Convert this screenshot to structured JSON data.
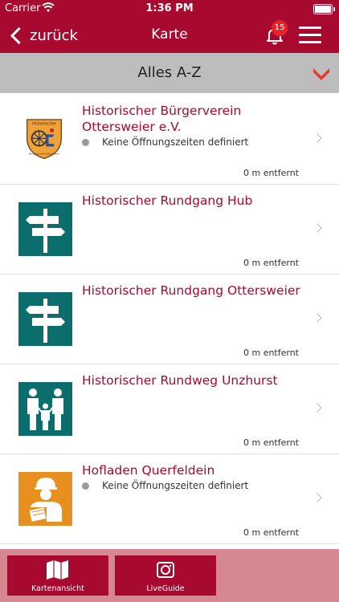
{
  "status_bar": {
    "carrier": "Carrier",
    "time": "1:36 PM"
  },
  "nav": {
    "back_label": "zurück",
    "title": "Karte",
    "notification_count": "15"
  },
  "filter": {
    "label": "Alles A-Z"
  },
  "items": [
    {
      "title": "Historischer Bürgerverein Ottersweier e.V.",
      "status": "Keine Öffnungszeiten definiert",
      "distance": "0 m entfernt",
      "icon": "association-logo-icon",
      "logo_text": "Historischer",
      "logo_text2": "Bürgerverein Ottersweier"
    },
    {
      "title": "Historischer Rundgang Hub",
      "distance": "0 m entfernt",
      "icon": "signpost-icon"
    },
    {
      "title": "Historischer Rundgang Ottersweier",
      "distance": "0 m entfernt",
      "icon": "signpost-icon"
    },
    {
      "title": "Historischer Rundweg Unzhurst",
      "distance": "0 m entfernt",
      "icon": "family-icon"
    },
    {
      "title": "Hofladen Querfeldein",
      "status": "Keine Öffnungszeiten definiert",
      "distance": "0 m entfernt",
      "icon": "worker-icon"
    }
  ],
  "bottom": {
    "map_view_label": "Kartenansicht",
    "live_guide_label": "LiveGuide"
  },
  "colors": {
    "primary": "#a7092f",
    "filter_bg": "#bdbdbd",
    "teal": "#0b6e6c",
    "orange": "#e8901f",
    "bottom_bg": "#d58890"
  }
}
